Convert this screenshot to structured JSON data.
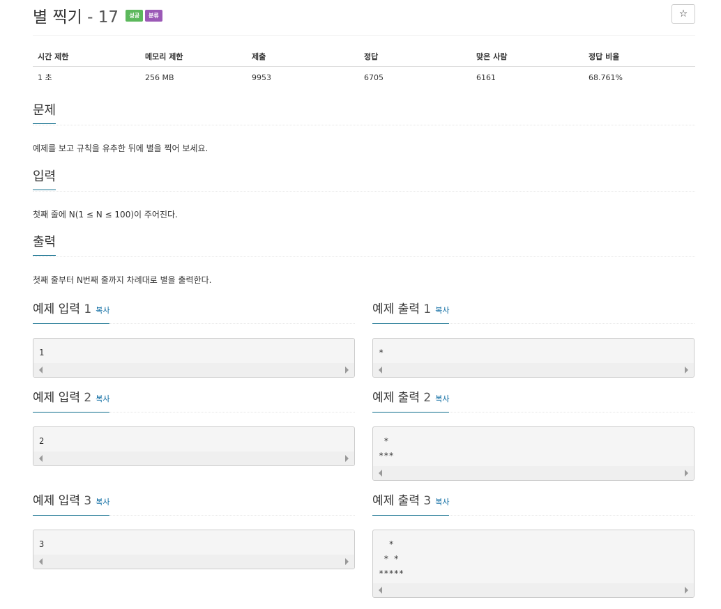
{
  "title": {
    "name": "별 찍기",
    "sep": "-",
    "num": "17",
    "badge_success": "성공",
    "badge_tag": "분류"
  },
  "star_button": "☆",
  "info": {
    "headers": [
      "시간 제한",
      "메모리 제한",
      "제출",
      "정답",
      "맞은 사람",
      "정답 비율"
    ],
    "values": [
      "1 초",
      "256 MB",
      "9953",
      "6705",
      "6161",
      "68.761%"
    ]
  },
  "problem": {
    "heading": "문제",
    "text": "예제를 보고 규칙을 유추한 뒤에 별을 찍어 보세요."
  },
  "input": {
    "heading": "입력",
    "text": "첫째 줄에 N(1 ≤ N ≤ 100)이 주어진다."
  },
  "output": {
    "heading": "출력",
    "text": "첫째 줄부터 N번째 줄까지 차례대로 별을 출력한다."
  },
  "copy_label": "복사",
  "examples": [
    {
      "in_title": "예제 입력",
      "out_title": "예제 출력",
      "n": "1",
      "input": "1",
      "output": "*"
    },
    {
      "in_title": "예제 입력",
      "out_title": "예제 출력",
      "n": "2",
      "input": "2",
      "output": " *\n***"
    },
    {
      "in_title": "예제 입력",
      "out_title": "예제 출력",
      "n": "3",
      "input": "3",
      "output": "  *\n * *\n*****"
    }
  ]
}
